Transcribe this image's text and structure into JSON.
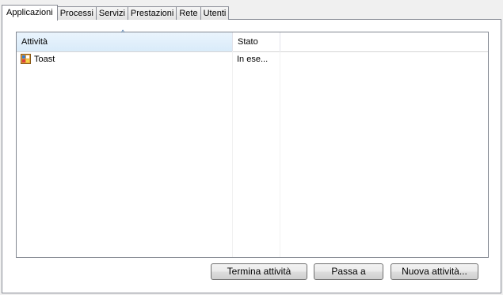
{
  "tabs": [
    {
      "label": "Applicazioni",
      "active": true
    },
    {
      "label": "Processi"
    },
    {
      "label": "Servizi"
    },
    {
      "label": "Prestazioni"
    },
    {
      "label": "Rete"
    },
    {
      "label": "Utenti"
    }
  ],
  "list": {
    "columns": [
      {
        "label": "Attività",
        "sorted": "ascending"
      },
      {
        "label": "Stato"
      }
    ],
    "rows": [
      {
        "icon": "app-window-icon",
        "task": "Toast",
        "status": "In ese..."
      }
    ]
  },
  "buttons": {
    "end_task": "Termina attività",
    "switch_to": "Passa a",
    "new_task": "Nuova attività..."
  }
}
